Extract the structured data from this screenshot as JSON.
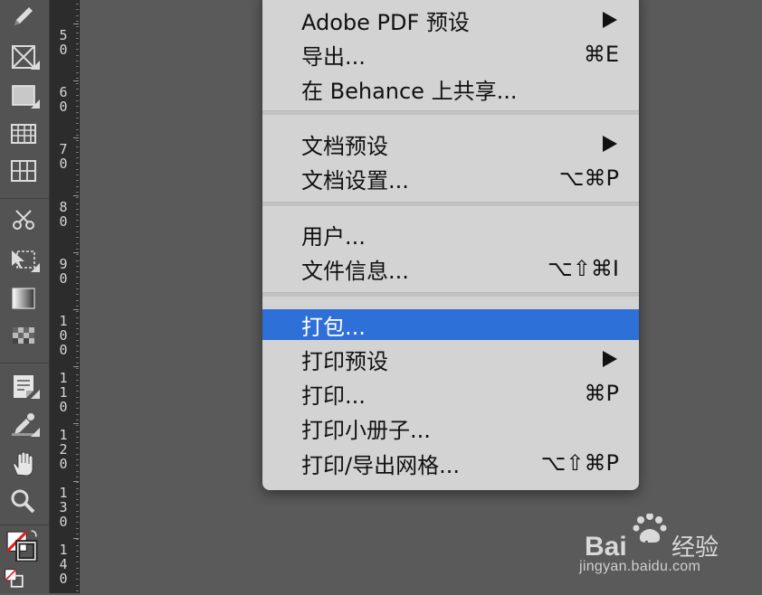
{
  "toolbar": {
    "tools": [
      {
        "icon": "pencil-icon"
      },
      {
        "icon": "frame-icon"
      },
      {
        "icon": "rectangle-icon"
      },
      {
        "icon": "table-icon"
      },
      {
        "icon": "grid-icon"
      },
      {
        "icon": "scissors-icon"
      },
      {
        "icon": "free-transform-icon"
      },
      {
        "icon": "gradient-swatch-icon"
      },
      {
        "icon": "gradient-feather-icon"
      },
      {
        "icon": "note-icon"
      },
      {
        "icon": "eyedropper-icon"
      },
      {
        "icon": "hand-icon"
      },
      {
        "icon": "zoom-icon"
      },
      {
        "icon": "fill-stroke-icon"
      },
      {
        "icon": "formatting-icon"
      }
    ]
  },
  "ruler": {
    "labels": [
      "5 0",
      "6 0",
      "7 0",
      "8 0",
      "9 0",
      "1 0 0",
      "1 1 0",
      "1 2 0",
      "1 3 0",
      "1 4 0"
    ]
  },
  "menu": {
    "items": [
      {
        "label": "Adobe PDF 预设",
        "shortcut": "",
        "submenu": true,
        "highlighted": false
      },
      {
        "label": "导出...",
        "shortcut": "⌘E",
        "submenu": false,
        "highlighted": false
      },
      {
        "label": "在 Behance 上共享...",
        "shortcut": "",
        "submenu": false,
        "highlighted": false
      },
      {
        "label": "文档预设",
        "shortcut": "",
        "submenu": true,
        "highlighted": false
      },
      {
        "label": "文档设置...",
        "shortcut": "⌥⌘P",
        "submenu": false,
        "highlighted": false
      },
      {
        "label": "用户...",
        "shortcut": "",
        "submenu": false,
        "highlighted": false
      },
      {
        "label": "文件信息...",
        "shortcut": "⌥⇧⌘I",
        "submenu": false,
        "highlighted": false
      },
      {
        "label": "打包...",
        "shortcut": "",
        "submenu": false,
        "highlighted": true
      },
      {
        "label": "打印预设",
        "shortcut": "",
        "submenu": true,
        "highlighted": false
      },
      {
        "label": "打印...",
        "shortcut": "⌘P",
        "submenu": false,
        "highlighted": false
      },
      {
        "label": "打印小册子...",
        "shortcut": "",
        "submenu": false,
        "highlighted": false
      },
      {
        "label": "打印/导出网格...",
        "shortcut": "⌥⇧⌘P",
        "submenu": false,
        "highlighted": false
      }
    ],
    "highlight_color": "#2f6fd8"
  },
  "watermark": {
    "logo_text": "Bai",
    "logo_text2": "du",
    "logo_text3": "经验",
    "url": "jingyan.baidu.com"
  }
}
